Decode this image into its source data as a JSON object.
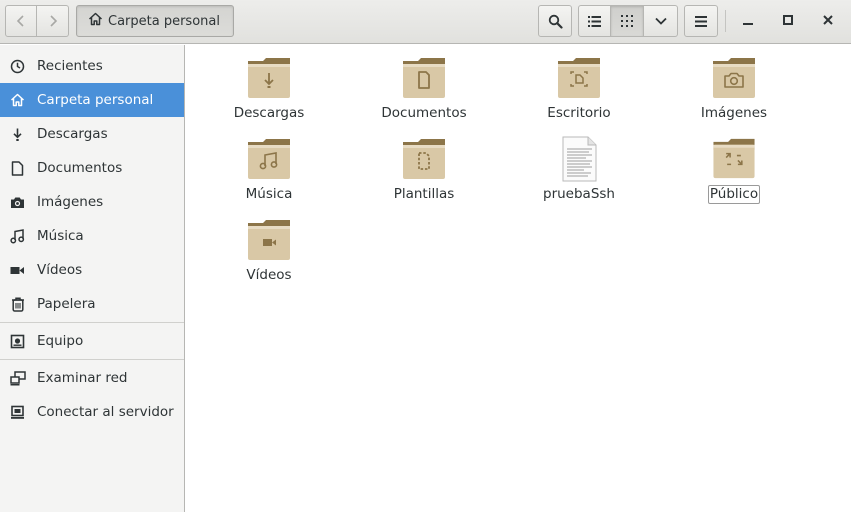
{
  "header": {
    "path_label": "Carpeta personal",
    "icons": {
      "back": "go-previous-icon",
      "forward": "go-next-icon",
      "home": "home-icon",
      "search": "search-icon",
      "list_view": "list-view-icon",
      "grid_view": "grid-view-icon",
      "view_options": "chevron-down-icon",
      "menu": "hamburger-menu-icon",
      "minimize": "minimize-icon",
      "maximize": "maximize-icon",
      "close": "close-icon"
    }
  },
  "sidebar": {
    "items": [
      {
        "label": "Recientes",
        "icon": "clock-icon"
      },
      {
        "label": "Carpeta personal",
        "icon": "home-icon",
        "selected": true
      },
      {
        "label": "Descargas",
        "icon": "download-icon"
      },
      {
        "label": "Documentos",
        "icon": "document-icon"
      },
      {
        "label": "Imágenes",
        "icon": "camera-icon"
      },
      {
        "label": "Música",
        "icon": "music-icon"
      },
      {
        "label": "Vídeos",
        "icon": "video-icon"
      },
      {
        "label": "Papelera",
        "icon": "trash-icon"
      },
      {
        "label": "Equipo",
        "icon": "computer-icon"
      },
      {
        "label": "Examinar red",
        "icon": "network-icon"
      },
      {
        "label": "Conectar al servidor",
        "icon": "server-icon"
      }
    ]
  },
  "files": [
    {
      "name": "Descargas",
      "type": "folder",
      "emblem": "download"
    },
    {
      "name": "Documentos",
      "type": "folder",
      "emblem": "document"
    },
    {
      "name": "Escritorio",
      "type": "folder",
      "emblem": "desktop"
    },
    {
      "name": "Imágenes",
      "type": "folder",
      "emblem": "camera"
    },
    {
      "name": "Música",
      "type": "folder",
      "emblem": "music"
    },
    {
      "name": "Plantillas",
      "type": "folder",
      "emblem": "template"
    },
    {
      "name": "pruebaSsh",
      "type": "text-file",
      "emblem": ""
    },
    {
      "name": "Público",
      "type": "folder",
      "emblem": "share",
      "focused": true
    },
    {
      "name": "Vídeos",
      "type": "folder",
      "emblem": "video"
    }
  ],
  "colors": {
    "accent": "#4a90d9",
    "folder_body": "#d9c8a6",
    "folder_tab": "#8c7549"
  }
}
